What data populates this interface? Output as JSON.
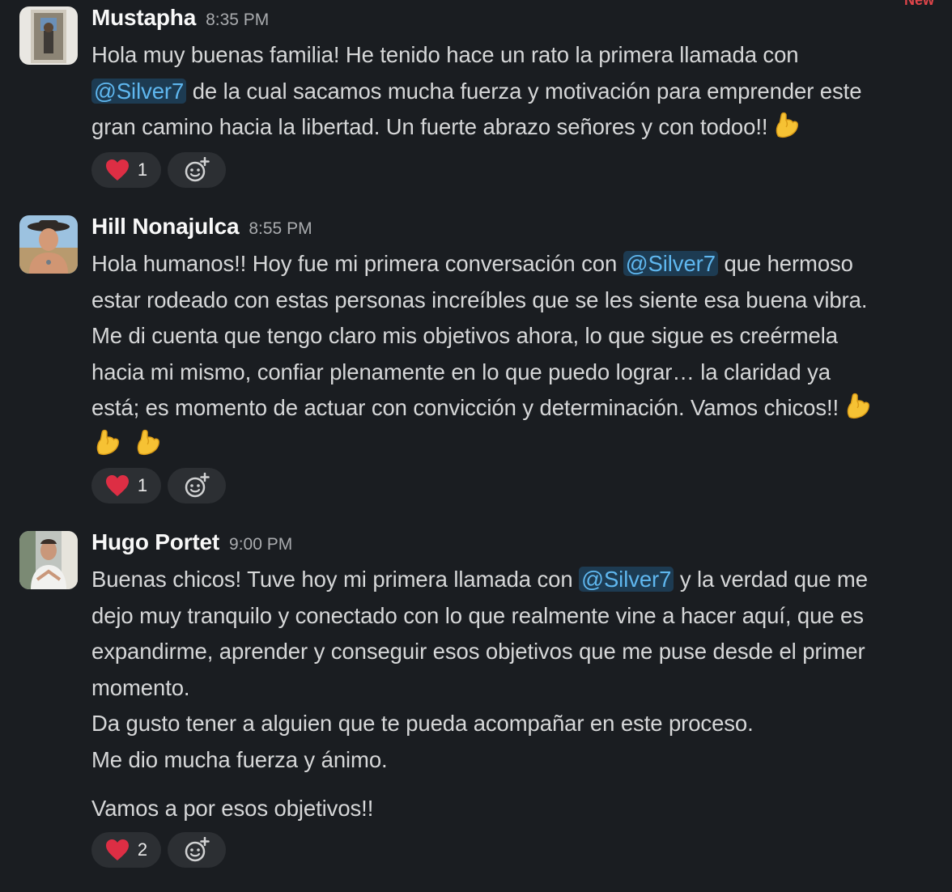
{
  "top_label": "New",
  "messages": [
    {
      "author": "Mustapha",
      "time": "8:35 PM",
      "lines": [
        "Hola muy buenas familia! He tenido hace un rato la primera llamada con",
        " de la cual sacamos mucha fuerza y motivación para emprender este",
        "gran camino hacia la libertad. Un fuerte abrazo señores y con todoo!!"
      ],
      "mention": "@Silver7",
      "reaction": {
        "emoji": "heart",
        "count": "1"
      }
    },
    {
      "author": "Hill Nonajulca",
      "time": "8:55 PM",
      "lines": [
        "Hola humanos!! Hoy fue mi primera conversación con ",
        " que hermoso",
        "estar rodeado con estas personas increíbles que se les siente esa buena vibra.",
        "Me di cuenta que tengo claro mis objetivos ahora, lo que sigue es creérmela",
        "hacia mi mismo, confiar plenamente en lo que puedo lograr… la claridad  ya",
        "está; es momento de actuar con convicción y determinación. Vamos chicos!!"
      ],
      "mention": "@Silver7",
      "reaction": {
        "emoji": "heart",
        "count": "1"
      }
    },
    {
      "author": "Hugo Portet",
      "time": "9:00 PM",
      "lines": [
        "Buenas chicos! Tuve hoy mi primera llamada con ",
        " y la verdad que me",
        "dejo muy tranquilo y conectado con lo que realmente vine a hacer aquí, que es",
        "expandirme, aprender y conseguir esos objetivos que me puse desde el primer",
        "momento.",
        "Da gusto tener a alguien que te pueda acompañar en este proceso.",
        "Me dio mucha fuerza y ánimo.",
        "Vamos a por esos objetivos!!"
      ],
      "mention": "@Silver7",
      "reaction": {
        "emoji": "heart",
        "count": "2"
      }
    }
  ],
  "icons": {
    "reaction": "red-heart-icon",
    "add_reaction": "add-reaction-icon",
    "emoji_in_text": "flexed-biceps-icon"
  },
  "colors": {
    "background": "#1a1d21",
    "mention_text": "#5fb7ef",
    "mention_bg": "#1d3b52",
    "pill_bg": "#2c2f33"
  }
}
